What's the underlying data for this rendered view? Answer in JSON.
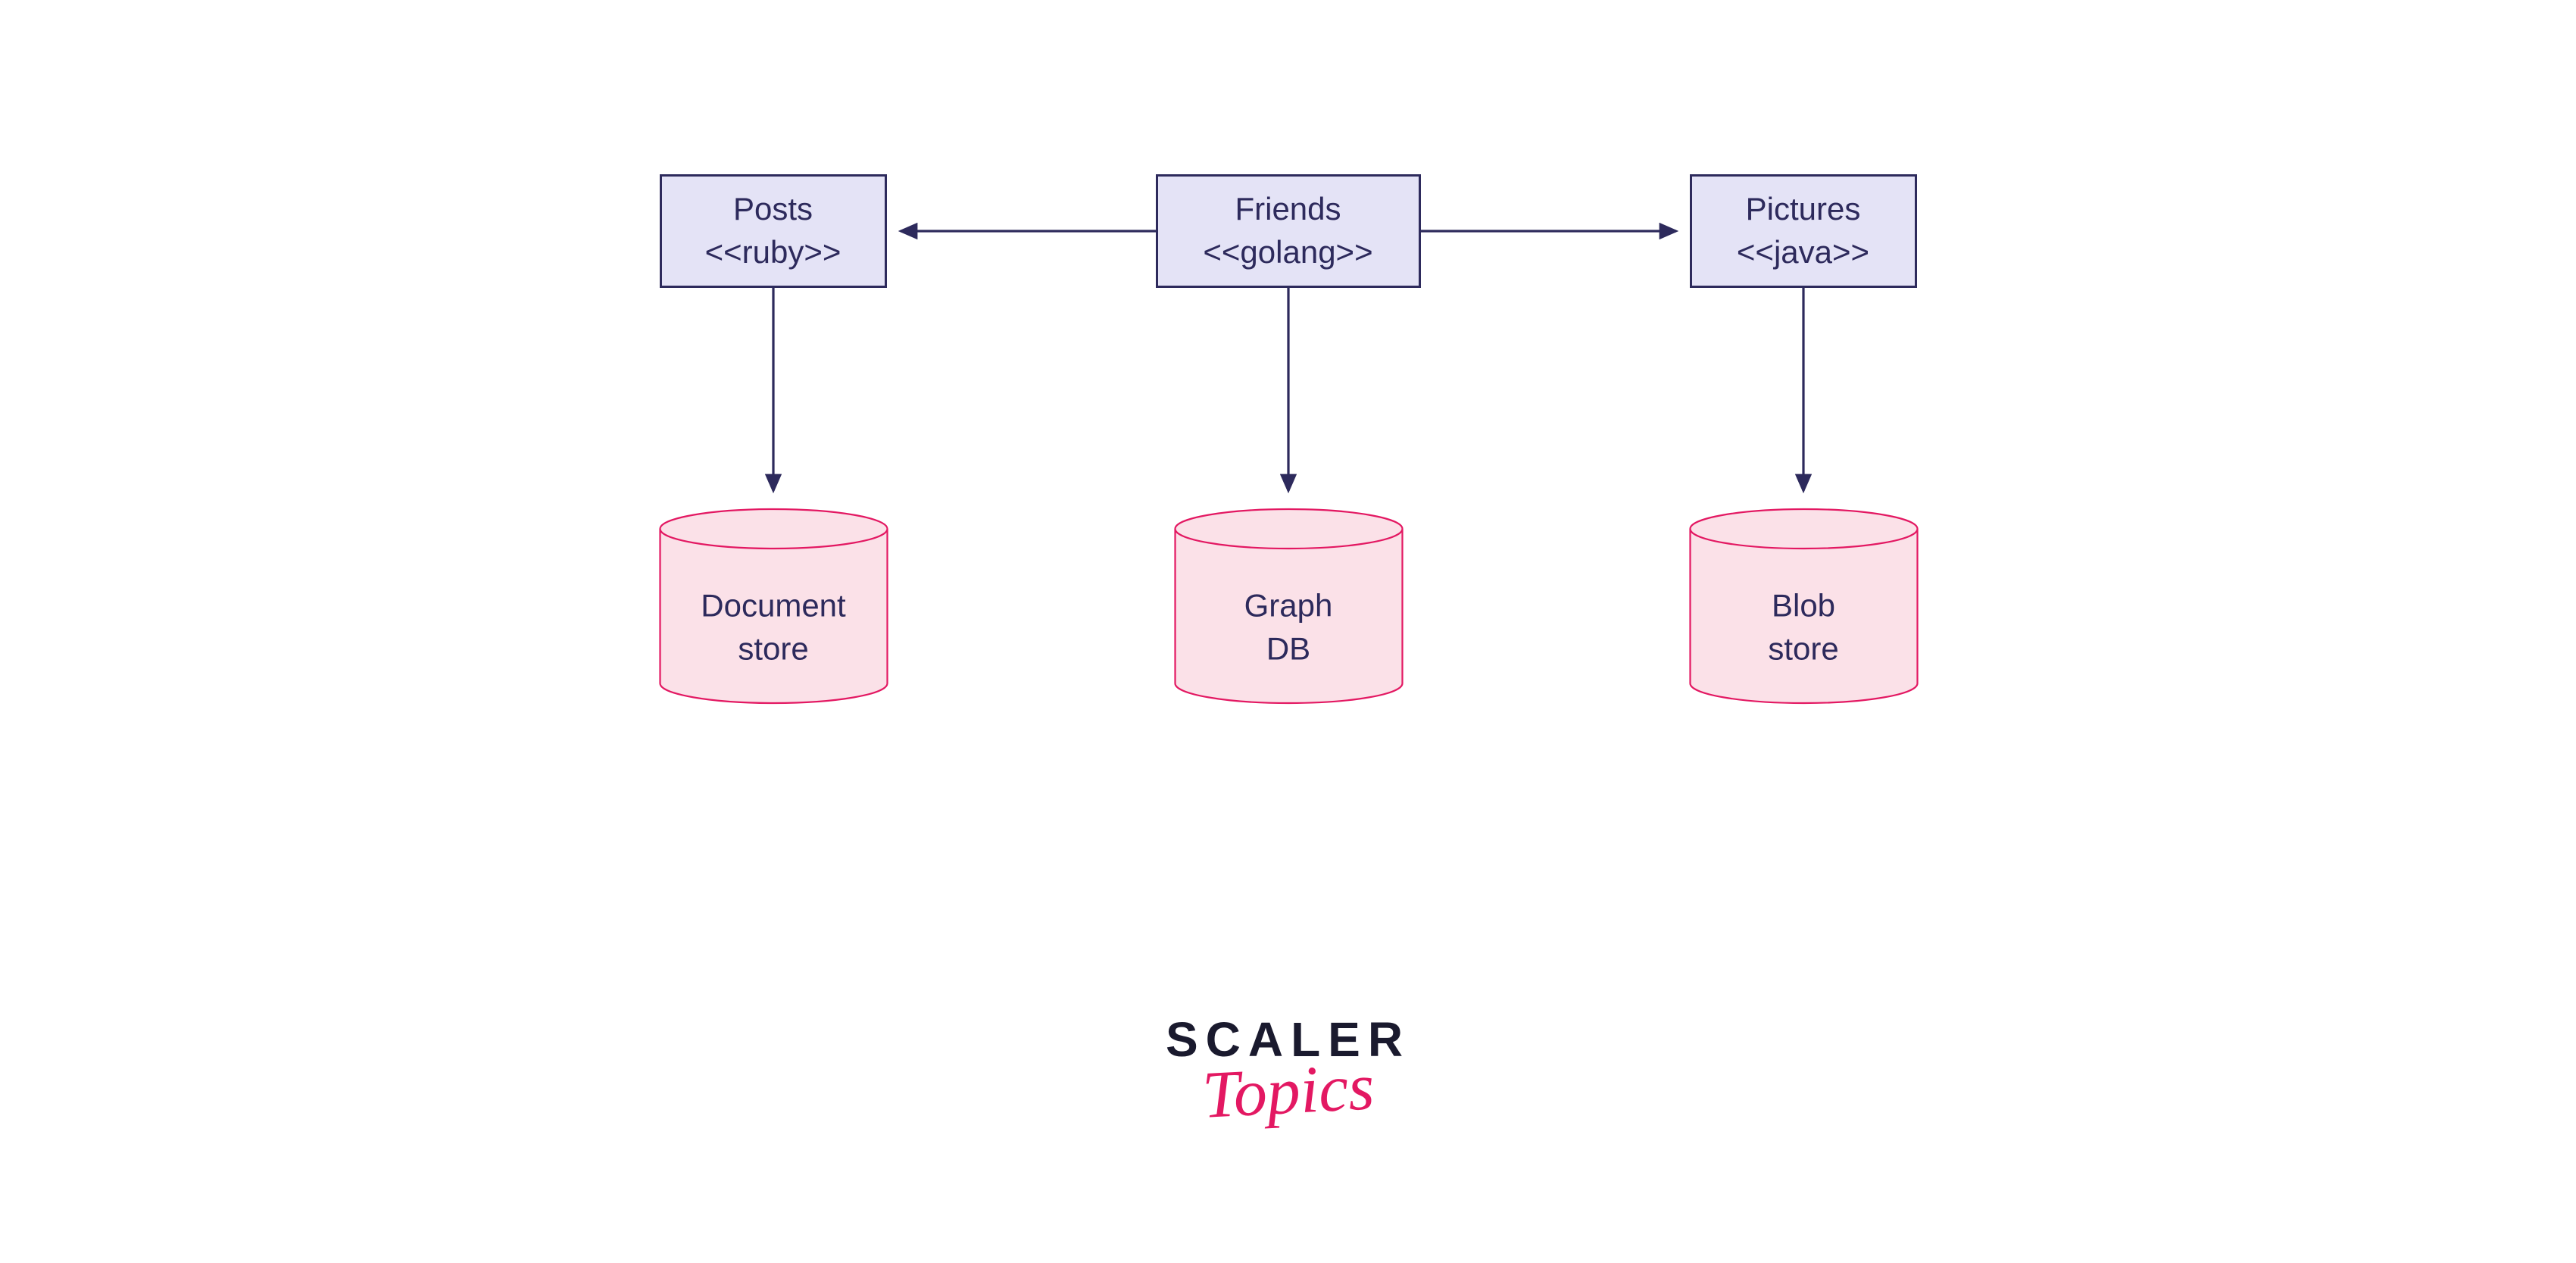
{
  "services": {
    "posts": {
      "title": "Posts",
      "tech": "<<ruby>>"
    },
    "friends": {
      "title": "Friends",
      "tech": "<<golang>>"
    },
    "pictures": {
      "title": "Pictures",
      "tech": "<<java>>"
    }
  },
  "stores": {
    "document": {
      "line1": "Document",
      "line2": "store"
    },
    "graph": {
      "line1": "Graph",
      "line2": "DB"
    },
    "blob": {
      "line1": "Blob",
      "line2": "store"
    }
  },
  "colors": {
    "box_fill": "#e4e3f6",
    "box_stroke": "#2d2a5c",
    "cyl_fill": "#fbe1e8",
    "cyl_stroke": "#e31862",
    "arrow": "#2d2a5c",
    "logo_dark": "#1a1a2e",
    "logo_pink": "#e31862"
  },
  "logo": {
    "line1": "SCALER",
    "line2": "Topics"
  }
}
